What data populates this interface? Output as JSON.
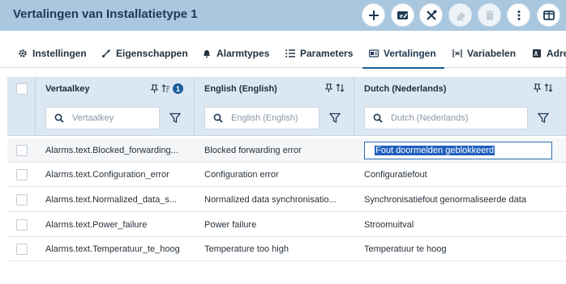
{
  "header": {
    "title": "Vertalingen van Installatietype 1",
    "buttons": [
      {
        "name": "add-button",
        "icon": "plus-icon",
        "enabled": true
      },
      {
        "name": "edit-button",
        "icon": "edit-icon",
        "enabled": true
      },
      {
        "name": "tools-button",
        "icon": "tools-icon",
        "enabled": true
      },
      {
        "name": "erase-button",
        "icon": "eraser-icon",
        "enabled": false
      },
      {
        "name": "delete-button",
        "icon": "trash-icon",
        "enabled": false
      },
      {
        "name": "more-button",
        "icon": "more-vertical-icon",
        "enabled": true
      },
      {
        "name": "columns-button",
        "icon": "columns-icon",
        "enabled": true
      }
    ]
  },
  "tabs": [
    {
      "label": "Instellingen",
      "icon": "gear-icon"
    },
    {
      "label": "Eigenschappen",
      "icon": "brush-icon"
    },
    {
      "label": "Alarmtypes",
      "icon": "bell-icon"
    },
    {
      "label": "Parameters",
      "icon": "list-icon"
    },
    {
      "label": "Vertalingen",
      "icon": "translate-icon",
      "active": true
    },
    {
      "label": "Variabelen",
      "icon": "variable-icon"
    },
    {
      "label": "Adre",
      "icon": "address-icon"
    }
  ],
  "grid": {
    "columns": [
      {
        "label": "Vertaalkey",
        "placeholder": "Vertaalkey",
        "sort_badge": "1"
      },
      {
        "label": "English (English)",
        "placeholder": "English (English)"
      },
      {
        "label": "Dutch (Nederlands)",
        "placeholder": "Dutch (Nederlands)"
      }
    ],
    "rows": [
      {
        "key": "Alarms.text.Blocked_forwarding...",
        "en": "Blocked forwarding error",
        "nl": "Fout doormelden geblokkeerd",
        "editing": true
      },
      {
        "key": "Alarms.text.Configuration_error",
        "en": "Configuration error",
        "nl": "Configuratiefout"
      },
      {
        "key": "Alarms.text.Normalized_data_s...",
        "en": "Normalized data synchronisatio...",
        "nl": "Synchronisatiefout genormaliseerde data"
      },
      {
        "key": "Alarms.text.Power_failure",
        "en": "Power failure",
        "nl": "Stroomuitval"
      },
      {
        "key": "Alarms.text.Temperatuur_te_hoog",
        "en": "Temperature too high",
        "nl": "Temperatuur te hoog"
      }
    ]
  },
  "colors": {
    "header_bg": "#a9c7df",
    "grid_header_bg": "#dbe7f2",
    "accent": "#1f5f99",
    "selection": "#1f5fbf"
  }
}
